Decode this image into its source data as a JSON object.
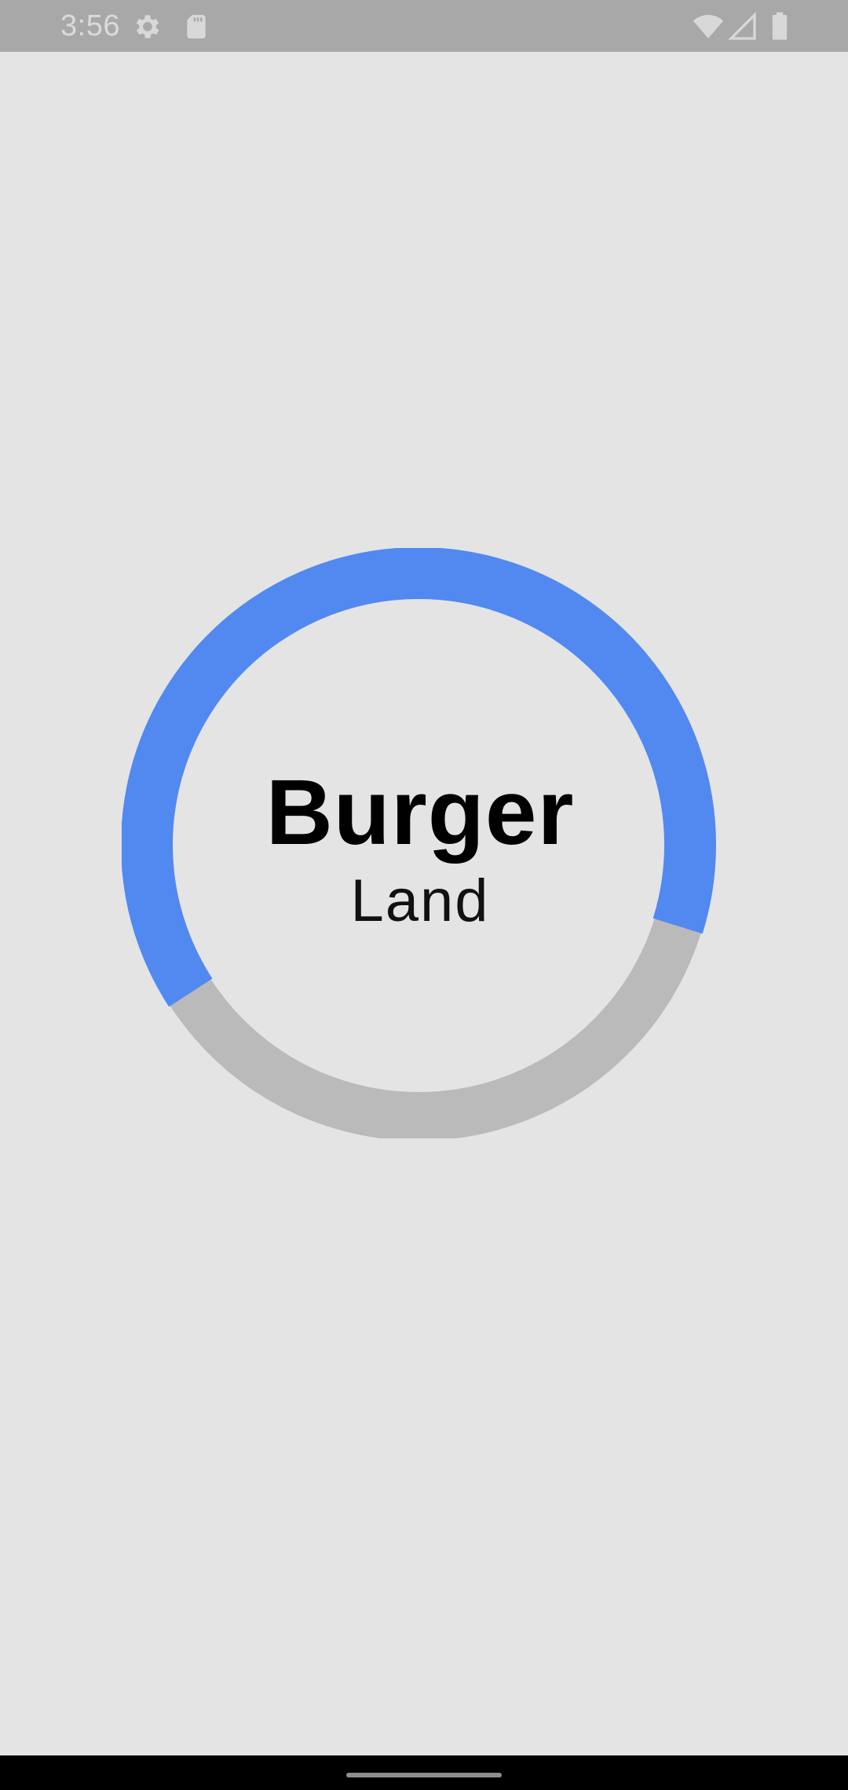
{
  "status_bar": {
    "time": "3:56",
    "left_icons": [
      "gear-icon",
      "sd-card-icon"
    ],
    "right_icons": [
      "wifi-icon",
      "cellular-signal-icon",
      "battery-icon"
    ]
  },
  "main": {
    "title": "Burger",
    "subtitle": "Land",
    "progress_ring": {
      "progress_fraction": 0.64,
      "progress_color": "#5289F0",
      "track_color": "#BABABA"
    }
  },
  "colors": {
    "background": "#E4E4E4",
    "status_bar": "#A8A8A8",
    "nav_bar": "#000000"
  },
  "nav_bar": {
    "handle": "home-gesture-handle"
  }
}
